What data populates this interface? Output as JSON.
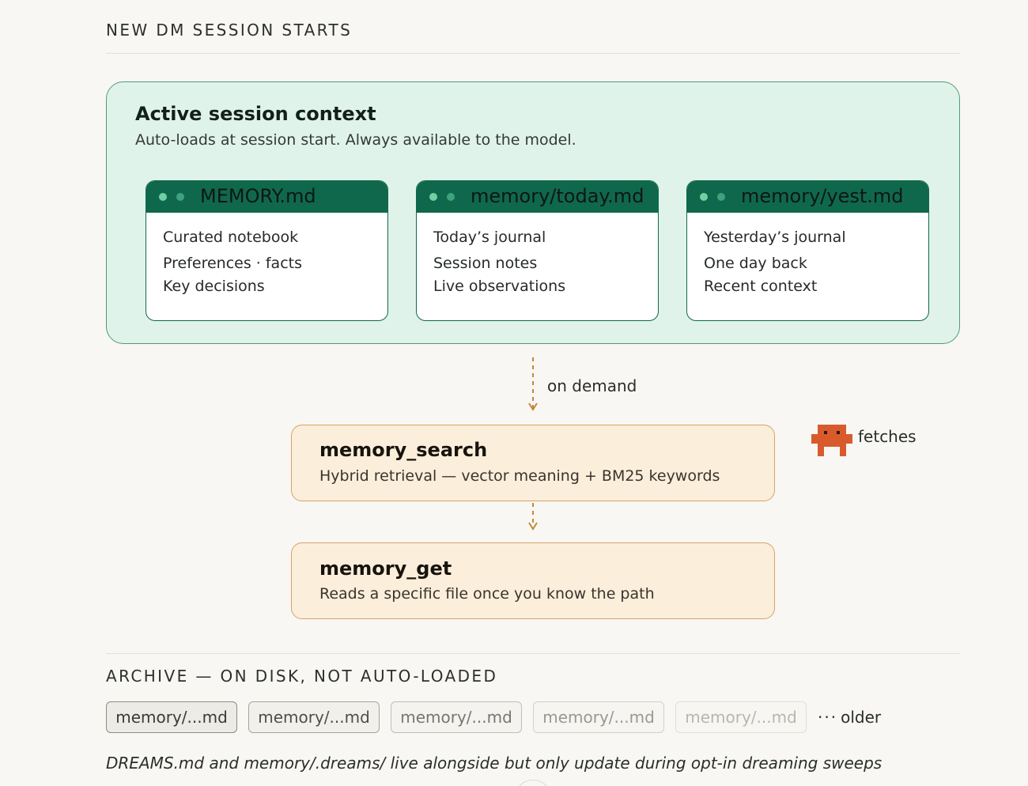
{
  "header": {
    "title": "NEW DM SESSION STARTS"
  },
  "context": {
    "title": "Active session context",
    "subtitle": "Auto-loads at session start. Always available to the model.",
    "cards": [
      {
        "file": "MEMORY.md",
        "lines": [
          "Curated notebook",
          "Preferences · facts",
          "Key decisions"
        ]
      },
      {
        "file": "memory/today.md",
        "lines": [
          "Today’s journal",
          "Session notes",
          "Live observations"
        ]
      },
      {
        "file": "memory/yest.md",
        "lines": [
          "Yesterday’s journal",
          "One day back",
          "Recent context"
        ]
      }
    ]
  },
  "flow": {
    "on_demand_label": "on demand",
    "fetches_label": "fetches"
  },
  "tools": [
    {
      "name": "memory_search",
      "desc": "Hybrid retrieval — vector meaning + BM25 keywords"
    },
    {
      "name": "memory_get",
      "desc": "Reads a specific file once you know the path"
    }
  ],
  "archive": {
    "title": "ARCHIVE — ON DISK, NOT AUTO-LOADED",
    "chips": [
      "memory/...md",
      "memory/...md",
      "memory/...md",
      "memory/...md",
      "memory/...md"
    ],
    "older_dots": "···",
    "older_label": "older"
  },
  "footnote": "DREAMS.md and memory/.dreams/ live alongside but only update during opt-in dreaming sweeps",
  "colors": {
    "accent_green": "#10684c",
    "context_bg": "#e0f3eb",
    "tool_bg": "#fbeedb",
    "dashed_arrow": "#c4883a",
    "mascot": "#d95b2c"
  },
  "icons": {
    "mascot": "pixel-robot-icon"
  }
}
